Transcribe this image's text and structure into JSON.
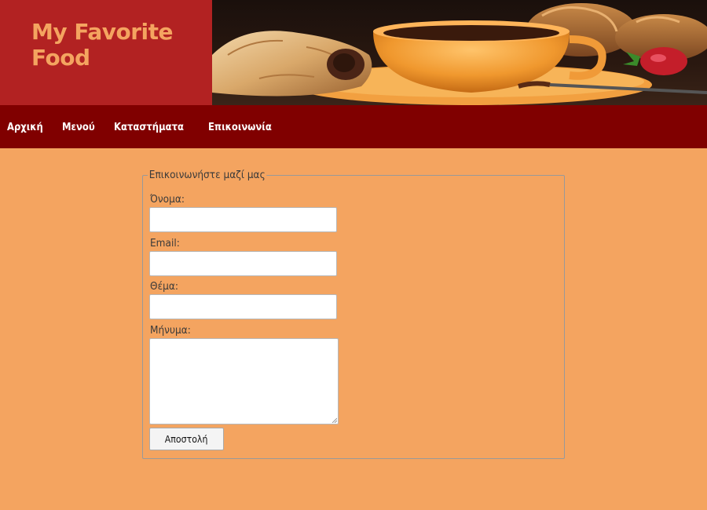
{
  "header": {
    "title": "My Favorite Food",
    "banner_image": "coffee-and-croissants-photo"
  },
  "nav": {
    "items": [
      {
        "label": "Αρχική"
      },
      {
        "label": "Μενού"
      },
      {
        "label": "Καταστήματα"
      },
      {
        "label": "Επικοινωνία"
      }
    ]
  },
  "form": {
    "legend": "Επικοινωνήστε μαζί μας",
    "name_label": "Όνομα:",
    "name_value": "",
    "email_label": "Email:",
    "email_value": "",
    "subject_label": "Θέμα:",
    "subject_value": "",
    "message_label": "Μήνυμα:",
    "message_value": "",
    "submit_label": "Αποστολή"
  },
  "colors": {
    "page_background": "#f4a460",
    "brand_background": "#b22222",
    "nav_background": "#800000",
    "title_color": "#f4a460"
  }
}
